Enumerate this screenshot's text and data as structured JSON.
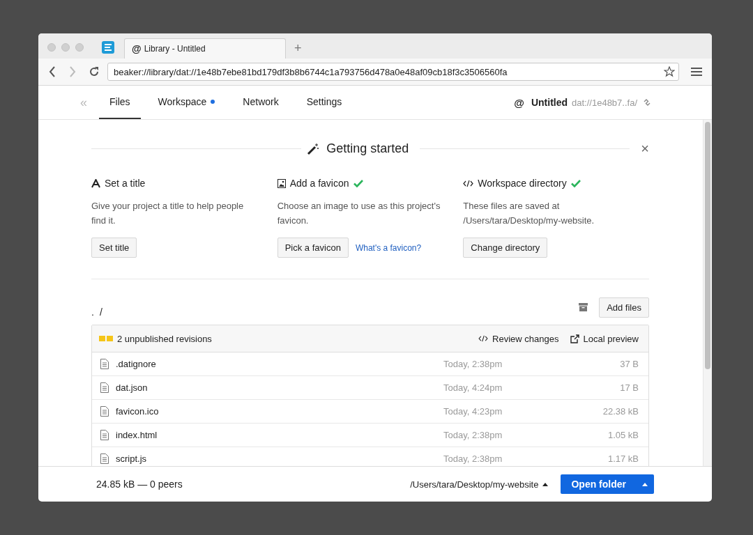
{
  "browser": {
    "tab": {
      "icon": "@",
      "title": "Library - Untitled",
      "selected": true
    },
    "new_tab": "+",
    "url": "beaker://library/dat://1e48b7ebe81bd179df3b8b6744c1a793756d478a0e48af09cb18f3c3506560fa"
  },
  "nav": {
    "collapse": "«",
    "tabs": [
      {
        "label": "Files",
        "selected": true,
        "dot": false
      },
      {
        "label": "Workspace",
        "selected": false,
        "dot": true
      },
      {
        "label": "Network",
        "selected": false,
        "dot": false
      },
      {
        "label": "Settings",
        "selected": false,
        "dot": false
      }
    ],
    "site": {
      "icon": "@",
      "title": "Untitled",
      "url": "dat://1e48b7..fa/"
    }
  },
  "getting_started": {
    "title": "Getting started",
    "close": "×",
    "cards": [
      {
        "kind": "title",
        "heading": "Set a title",
        "done": false,
        "text": "Give your project a title to help people find it.",
        "button": "Set title"
      },
      {
        "kind": "favicon",
        "heading": "Add a favicon",
        "done": true,
        "text": "Choose an image to use as this project's favicon.",
        "button": "Pick a favicon",
        "link": "What's a favicon?"
      },
      {
        "kind": "code",
        "heading": "Workspace directory",
        "done": true,
        "text": "These files are saved at /Users/tara/Desktop/my-website.",
        "button": "Change directory"
      }
    ]
  },
  "files": {
    "breadcrumb": [
      ".",
      "/"
    ],
    "add_button": "Add files",
    "revisions": "2 unpublished revisions",
    "review": "Review changes",
    "preview": "Local preview",
    "rows": [
      {
        "name": ".datignore",
        "modified": "Today, 2:38pm",
        "size": "37 B"
      },
      {
        "name": "dat.json",
        "modified": "Today, 4:24pm",
        "size": "17 B"
      },
      {
        "name": "favicon.ico",
        "modified": "Today, 4:23pm",
        "size": "22.38 kB"
      },
      {
        "name": "index.html",
        "modified": "Today, 2:38pm",
        "size": "1.05 kB"
      },
      {
        "name": "script.js",
        "modified": "Today, 2:38pm",
        "size": "1.17 kB"
      }
    ]
  },
  "footer": {
    "stats": "24.85 kB — 0 peers",
    "path": "/Users/tara/Desktop/my-website",
    "open_button": "Open folder"
  }
}
